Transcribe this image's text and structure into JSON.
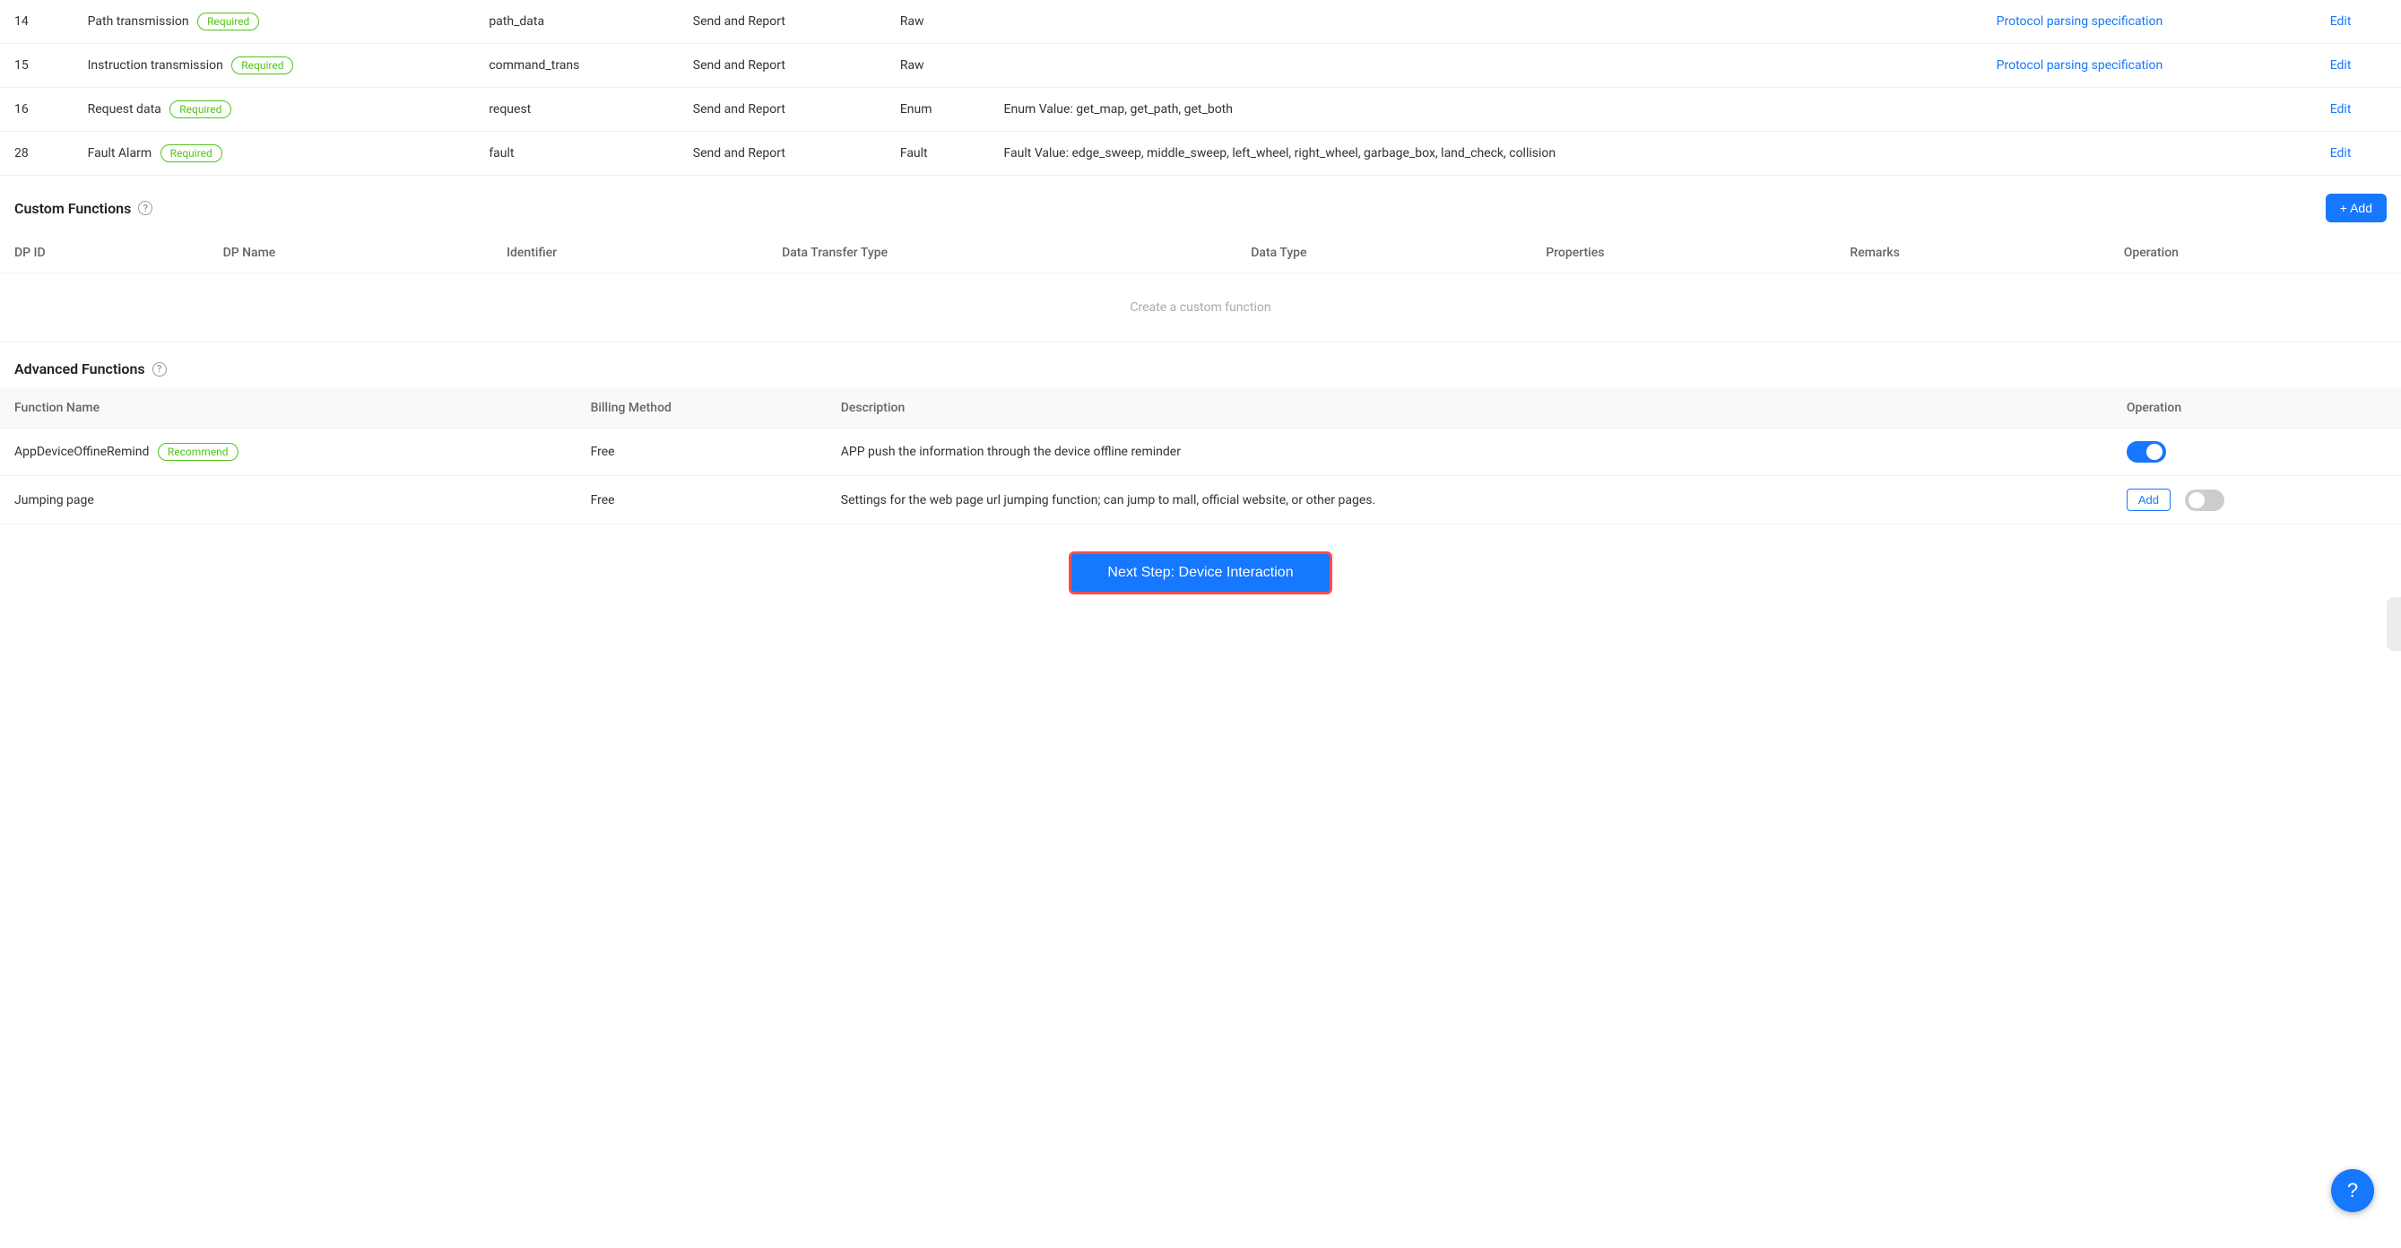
{
  "standard_rows": [
    {
      "id": "14",
      "name": "Path transmission",
      "badge": "Required",
      "identifier": "path_data",
      "transfer_type": "Send and Report",
      "data_type": "Raw",
      "properties": "",
      "remarks_link": "Protocol parsing specification",
      "operation": "Edit"
    },
    {
      "id": "15",
      "name": "Instruction transmission",
      "badge": "Required",
      "identifier": "command_trans",
      "transfer_type": "Send and Report",
      "data_type": "Raw",
      "properties": "",
      "remarks_link": "Protocol parsing specification",
      "operation": "Edit"
    },
    {
      "id": "16",
      "name": "Request data",
      "badge": "Required",
      "identifier": "request",
      "transfer_type": "Send and Report",
      "data_type": "Enum",
      "properties": "Enum Value: get_map, get_path, get_both",
      "remarks_link": "",
      "operation": "Edit"
    },
    {
      "id": "28",
      "name": "Fault Alarm",
      "badge": "Required",
      "identifier": "fault",
      "transfer_type": "Send and Report",
      "data_type": "Fault",
      "properties": "Fault Value: edge_sweep, middle_sweep, left_wheel, right_wheel, garbage_box, land_check, collision",
      "remarks_link": "",
      "operation": "Edit"
    }
  ],
  "custom_section": {
    "title": "Custom Functions",
    "add_button": "+ Add",
    "columns": [
      "DP ID",
      "DP Name",
      "Identifier",
      "Data Transfer Type",
      "Data Type",
      "Properties",
      "Remarks",
      "Operation"
    ],
    "empty_text": "Create a custom function"
  },
  "advanced_section": {
    "title": "Advanced Functions",
    "columns": [
      "Function Name",
      "Billing Method",
      "Description",
      "Operation"
    ],
    "rows": [
      {
        "name": "AppDeviceOffineRemind",
        "badge": "Recommend",
        "billing": "Free",
        "description": "APP push the information through the device offline reminder",
        "toggle": true,
        "add_btn": false
      },
      {
        "name": "Jumping page",
        "badge": "",
        "billing": "Free",
        "description": "Settings for the web page url jumping function; can jump to mall, official website, or other pages.",
        "toggle": false,
        "add_btn": true
      }
    ]
  },
  "next_step": {
    "label": "Next Step: Device Interaction"
  },
  "help": {
    "label": "?"
  }
}
